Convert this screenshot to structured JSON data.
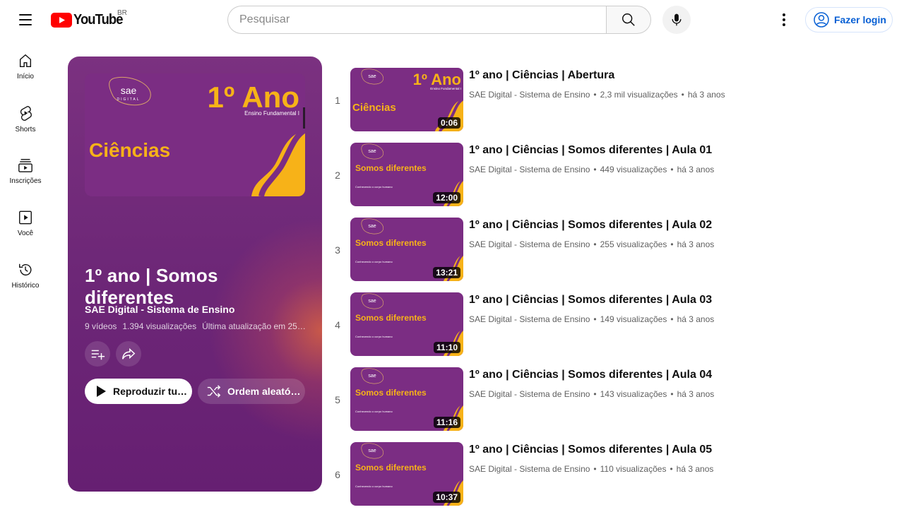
{
  "header": {
    "logo_text": "YouTube",
    "country": "BR",
    "search_placeholder": "Pesquisar",
    "login_label": "Fazer login",
    "brand_color": "#ff0000",
    "accent_color": "#065fd4"
  },
  "sidebar": {
    "items": [
      {
        "label": "Início",
        "icon": "home-icon"
      },
      {
        "label": "Shorts",
        "icon": "shorts-icon"
      },
      {
        "label": "Inscrições",
        "icon": "subscriptions-icon"
      },
      {
        "label": "Você",
        "icon": "you-icon"
      },
      {
        "label": "Histórico",
        "icon": "history-icon"
      }
    ]
  },
  "playlist": {
    "title": "1º ano | Somos diferentes",
    "channel": "SAE Digital - Sistema de Ensino",
    "video_count": "9 vídeos",
    "views": "1.394 visualizações",
    "updated": "Última atualização em 25…",
    "play_all_label": "Reproduzir tu…",
    "shuffle_label": "Ordem aleató…",
    "cover": {
      "brand": "sae",
      "brand_sub": "DIGITAL",
      "grade": "1º Ano",
      "level": "Ensino Fundamental I",
      "subject": "Ciências"
    },
    "colors": {
      "purple": "#7b2d83",
      "yellow": "#f7b218"
    }
  },
  "videos": [
    {
      "index": "1",
      "title": "1º ano | Ciências | Abertura",
      "channel": "SAE Digital - Sistema de Ensino",
      "views": "2,3 mil visualizações",
      "age": "há 3 anos",
      "duration": "0:06",
      "style": "intro",
      "thumb": {
        "brand": "sae",
        "grade": "1º Ano",
        "level": "Ensino Fundamental I",
        "subject": "Ciências"
      }
    },
    {
      "index": "2",
      "title": "1º ano | Ciências | Somos diferentes | Aula 01",
      "channel": "SAE Digital - Sistema de Ensino",
      "views": "449 visualizações",
      "age": "há 3 anos",
      "duration": "12:00",
      "style": "lesson",
      "thumb": {
        "brand": "sae",
        "heading": "Somos diferentes",
        "sub": "Conhecendo o corpo humano"
      }
    },
    {
      "index": "3",
      "title": "1º ano | Ciências | Somos diferentes | Aula 02",
      "channel": "SAE Digital - Sistema de Ensino",
      "views": "255 visualizações",
      "age": "há 3 anos",
      "duration": "13:21",
      "style": "lesson",
      "thumb": {
        "brand": "sae",
        "heading": "Somos diferentes",
        "sub": "Conhecendo o corpo humano"
      }
    },
    {
      "index": "4",
      "title": "1º ano | Ciências | Somos diferentes | Aula 03",
      "channel": "SAE Digital - Sistema de Ensino",
      "views": "149 visualizações",
      "age": "há 3 anos",
      "duration": "11:10",
      "style": "lesson",
      "thumb": {
        "brand": "sae",
        "heading": "Somos diferentes",
        "sub": "Conhecendo o corpo humano"
      }
    },
    {
      "index": "5",
      "title": "1º ano | Ciências | Somos diferentes | Aula 04",
      "channel": "SAE Digital - Sistema de Ensino",
      "views": "143 visualizações",
      "age": "há 3 anos",
      "duration": "11:16",
      "style": "lesson",
      "thumb": {
        "brand": "sae",
        "heading": "Somos diferentes",
        "sub": "Conhecendo o corpo humano"
      }
    },
    {
      "index": "6",
      "title": "1º ano | Ciências | Somos diferentes | Aula 05",
      "channel": "SAE Digital - Sistema de Ensino",
      "views": "110 visualizações",
      "age": "há 3 anos",
      "duration": "10:37",
      "style": "lesson",
      "thumb": {
        "brand": "sae",
        "heading": "Somos diferentes",
        "sub": "Conhecendo o corpo humano"
      }
    }
  ]
}
